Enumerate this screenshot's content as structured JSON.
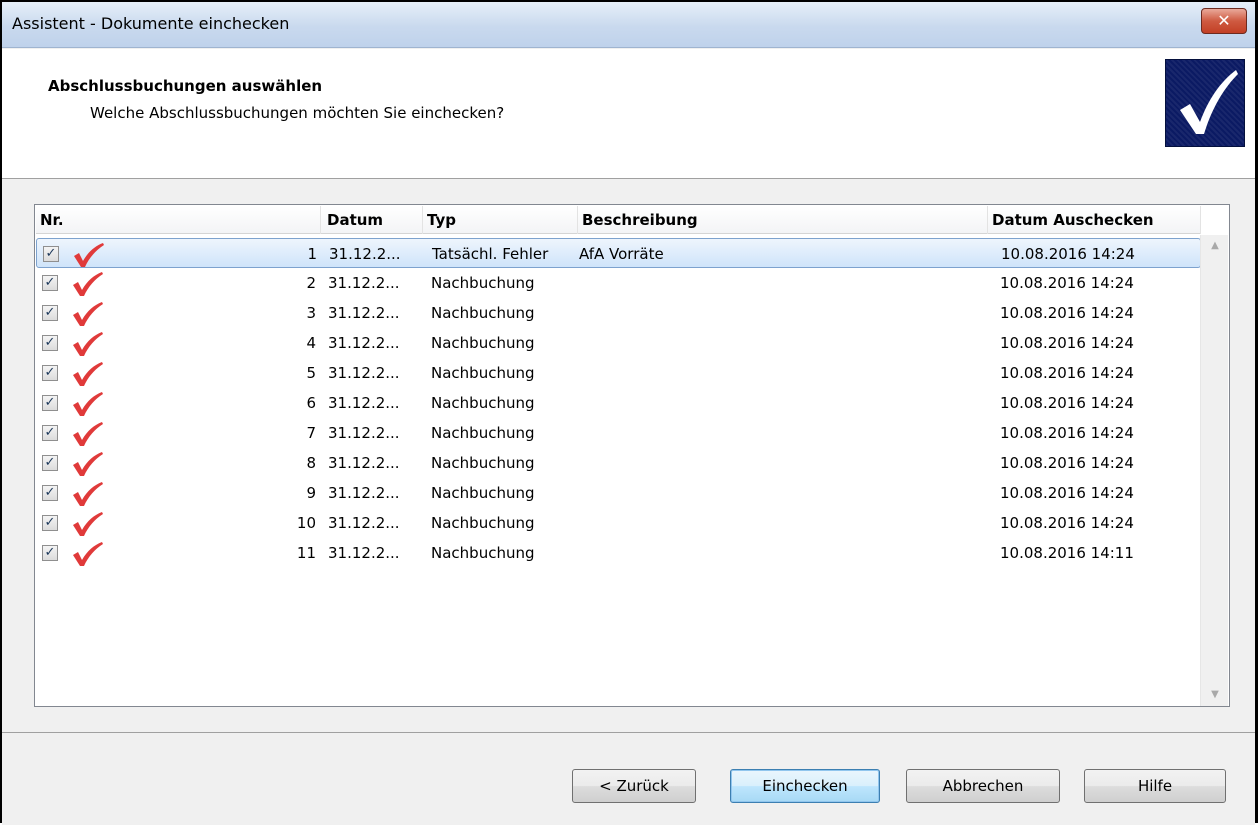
{
  "window": {
    "title": "Assistent - Dokumente einchecken",
    "close_glyph": "✕"
  },
  "header": {
    "title": "Abschlussbuchungen auswählen",
    "subtitle": "Welche Abschlussbuchungen möchten Sie einchecken?",
    "logo_icon": "checkmark-logo-icon"
  },
  "table": {
    "columns": [
      "Nr.",
      "Datum",
      "Typ",
      "Beschreibung",
      "Datum Auschecken"
    ],
    "rows": [
      {
        "checked": true,
        "nr": "1",
        "datum": "31.12.2...",
        "typ": "Tatsächl. Fehler",
        "beschreibung": "AfA Vorräte",
        "datum_auschecken": "10.08.2016 14:24",
        "selected": true
      },
      {
        "checked": true,
        "nr": "2",
        "datum": "31.12.2...",
        "typ": "Nachbuchung",
        "beschreibung": "",
        "datum_auschecken": "10.08.2016 14:24"
      },
      {
        "checked": true,
        "nr": "3",
        "datum": "31.12.2...",
        "typ": "Nachbuchung",
        "beschreibung": "",
        "datum_auschecken": "10.08.2016 14:24"
      },
      {
        "checked": true,
        "nr": "4",
        "datum": "31.12.2...",
        "typ": "Nachbuchung",
        "beschreibung": "",
        "datum_auschecken": "10.08.2016 14:24"
      },
      {
        "checked": true,
        "nr": "5",
        "datum": "31.12.2...",
        "typ": "Nachbuchung",
        "beschreibung": "",
        "datum_auschecken": "10.08.2016 14:24"
      },
      {
        "checked": true,
        "nr": "6",
        "datum": "31.12.2...",
        "typ": "Nachbuchung",
        "beschreibung": "",
        "datum_auschecken": "10.08.2016 14:24"
      },
      {
        "checked": true,
        "nr": "7",
        "datum": "31.12.2...",
        "typ": "Nachbuchung",
        "beschreibung": "",
        "datum_auschecken": "10.08.2016 14:24"
      },
      {
        "checked": true,
        "nr": "8",
        "datum": "31.12.2...",
        "typ": "Nachbuchung",
        "beschreibung": "",
        "datum_auschecken": "10.08.2016 14:24"
      },
      {
        "checked": true,
        "nr": "9",
        "datum": "31.12.2...",
        "typ": "Nachbuchung",
        "beschreibung": "",
        "datum_auschecken": "10.08.2016 14:24"
      },
      {
        "checked": true,
        "nr": "10",
        "datum": "31.12.2...",
        "typ": "Nachbuchung",
        "beschreibung": "",
        "datum_auschecken": "10.08.2016 14:24"
      },
      {
        "checked": true,
        "nr": "11",
        "datum": "31.12.2...",
        "typ": "Nachbuchung",
        "beschreibung": "",
        "datum_auschecken": "10.08.2016 14:11"
      }
    ],
    "row_icon": "red-checkmark-icon",
    "check_glyph": "✓",
    "tick_color": "#e03a3a"
  },
  "buttons": {
    "back": "< Zurück",
    "checkin": "Einchecken",
    "cancel": "Abbrechen",
    "help": "Hilfe"
  },
  "scrollbar": {
    "up_glyph": "▲",
    "down_glyph": "▼"
  }
}
